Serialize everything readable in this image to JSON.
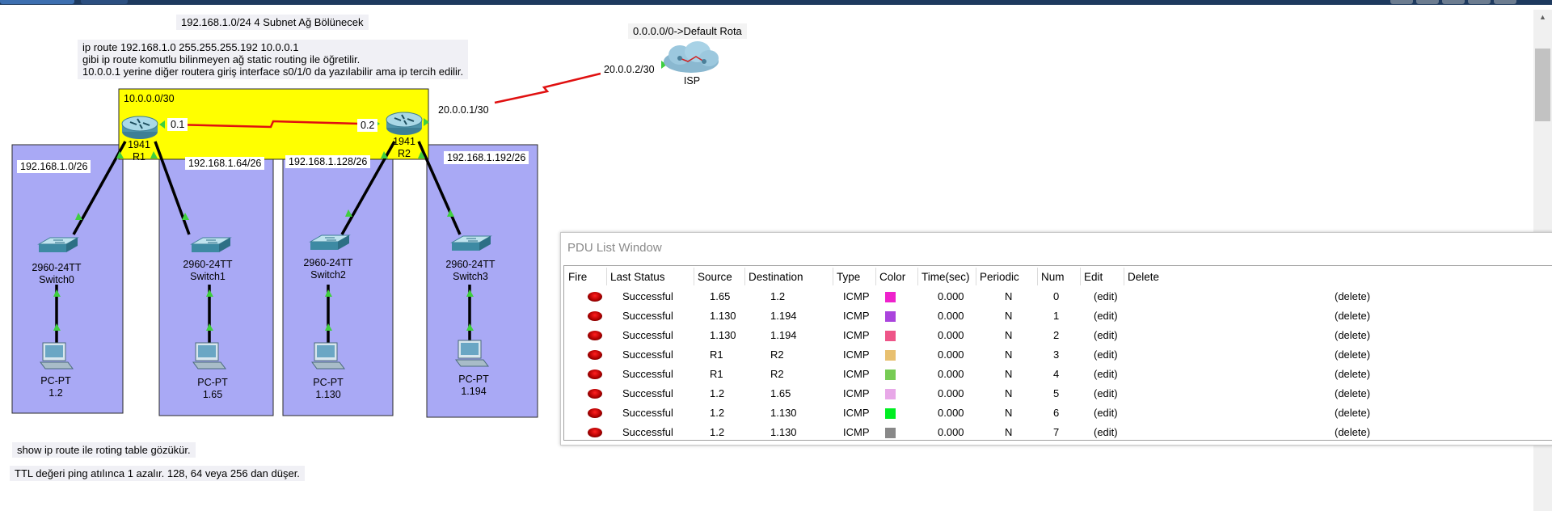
{
  "topology": {
    "title_note": "192.168.1.0/24  4 Subnet Ağ Bölünecek",
    "route_note": [
      "ip route 192.168.1.0 255.255.255.192 10.0.0.1",
      "gibi ip route komutlu bilinmeyen ağ static routing ile öğretilir.",
      "10.0.0.1 yerine diğer routera giriş interface s0/1/0 da yazılabilir ama ip tercih edilir."
    ],
    "default_route_note": "0.0.0.0/0->Default Rota",
    "isp_link_label": "20.0.0.2/30",
    "isp_name": "ISP",
    "r2_isp_label": "20.0.0.1/30",
    "wan_net_label": "10.0.0.0/30",
    "r1_if_label": "0.1",
    "r2_if_label": "0.2",
    "router1": {
      "model": "1941",
      "name": "R1"
    },
    "router2": {
      "model": "1941",
      "name": "R2"
    },
    "subnets": [
      "192.168.1.0/26",
      "192.168.1.64/26",
      "192.168.1.128/26",
      "192.168.1.192/26"
    ],
    "switches": [
      {
        "model": "2960-24TT",
        "name": "Switch0"
      },
      {
        "model": "2960-24TT",
        "name": "Switch1"
      },
      {
        "model": "2960-24TT",
        "name": "Switch2"
      },
      {
        "model": "2960-24TT",
        "name": "Switch3"
      }
    ],
    "pcs": [
      {
        "model": "PC-PT",
        "name": "1.2"
      },
      {
        "model": "PC-PT",
        "name": "1.65"
      },
      {
        "model": "PC-PT",
        "name": "1.130"
      },
      {
        "model": "PC-PT",
        "name": "1.194"
      }
    ],
    "bottom_notes": [
      "show ip route ile roting table gözükür.",
      "TTL değeri ping atılınca 1 azalır. 128, 64 veya 256 dan düşer."
    ],
    "colors": {
      "subnet_area": "#a9a9f5",
      "wan_area": "#ffff00",
      "serial_link": "#e01010",
      "port_up": "#3fcf3f"
    }
  },
  "pdu_window": {
    "title": "PDU List Window",
    "columns": [
      "Fire",
      "Last Status",
      "Source",
      "Destination",
      "Type",
      "Color",
      "Time(sec)",
      "Periodic",
      "Num",
      "Edit",
      "Delete"
    ],
    "rows": [
      {
        "status": "Successful",
        "source": "1.65",
        "destination": "1.2",
        "type": "ICMP",
        "color": "#ee22cc",
        "time": "0.000",
        "periodic": "N",
        "num": "0",
        "edit": "(edit)",
        "delete": "(delete)"
      },
      {
        "status": "Successful",
        "source": "1.130",
        "destination": "1.194",
        "type": "ICMP",
        "color": "#aa44dd",
        "time": "0.000",
        "periodic": "N",
        "num": "1",
        "edit": "(edit)",
        "delete": "(delete)"
      },
      {
        "status": "Successful",
        "source": "1.130",
        "destination": "1.194",
        "type": "ICMP",
        "color": "#ee5588",
        "time": "0.000",
        "periodic": "N",
        "num": "2",
        "edit": "(edit)",
        "delete": "(delete)"
      },
      {
        "status": "Successful",
        "source": "R1",
        "destination": "R2",
        "type": "ICMP",
        "color": "#e8c070",
        "time": "0.000",
        "periodic": "N",
        "num": "3",
        "edit": "(edit)",
        "delete": "(delete)"
      },
      {
        "status": "Successful",
        "source": "R1",
        "destination": "R2",
        "type": "ICMP",
        "color": "#77cc55",
        "time": "0.000",
        "periodic": "N",
        "num": "4",
        "edit": "(edit)",
        "delete": "(delete)"
      },
      {
        "status": "Successful",
        "source": "1.2",
        "destination": "1.65",
        "type": "ICMP",
        "color": "#e8a8e8",
        "time": "0.000",
        "periodic": "N",
        "num": "5",
        "edit": "(edit)",
        "delete": "(delete)"
      },
      {
        "status": "Successful",
        "source": "1.2",
        "destination": "1.130",
        "type": "ICMP",
        "color": "#00ee22",
        "time": "0.000",
        "periodic": "N",
        "num": "6",
        "edit": "(edit)",
        "delete": "(delete)"
      },
      {
        "status": "Successful",
        "source": "1.2",
        "destination": "1.130",
        "type": "ICMP",
        "color": "#888888",
        "time": "0.000",
        "periodic": "N",
        "num": "7",
        "edit": "(edit)",
        "delete": "(delete)"
      }
    ]
  }
}
